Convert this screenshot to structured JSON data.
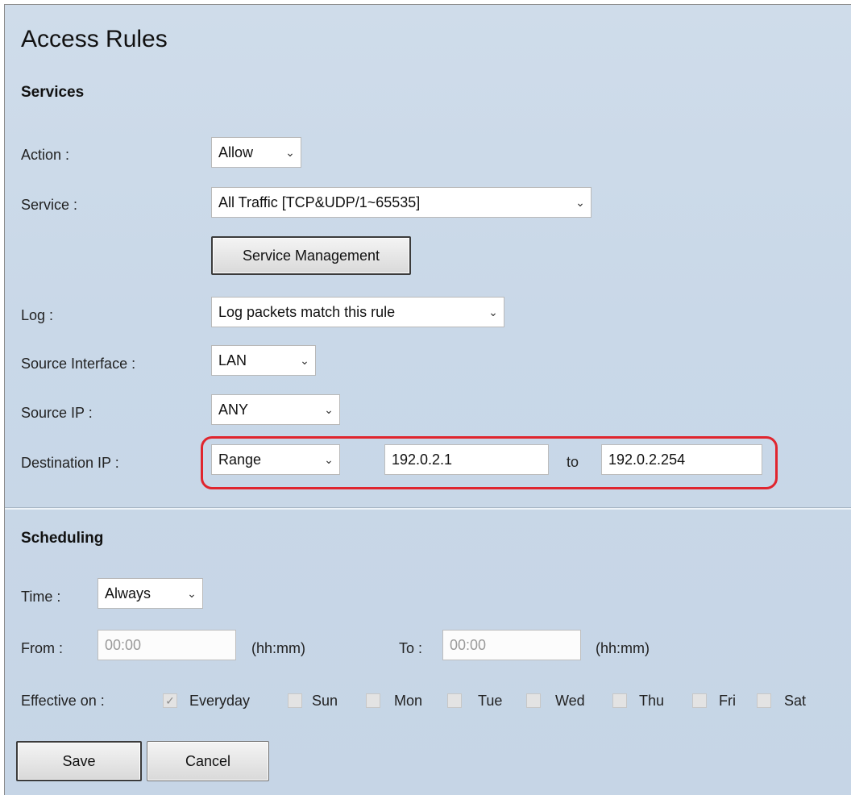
{
  "page": {
    "title": "Access Rules"
  },
  "services": {
    "heading": "Services",
    "action_label": "Action :",
    "action_value": "Allow",
    "service_label": "Service :",
    "service_value": "All Traffic [TCP&UDP/1~65535]",
    "service_mgmt_button": "Service Management",
    "log_label": "Log :",
    "log_value": "Log packets match this rule",
    "source_interface_label": "Source Interface :",
    "source_interface_value": "LAN",
    "source_ip_label": "Source IP :",
    "source_ip_value": "ANY",
    "dest_ip_label": "Destination IP :",
    "dest_ip_mode": "Range",
    "dest_ip_from": "192.0.2.1",
    "dest_ip_to_label": "to",
    "dest_ip_to": "192.0.2.254"
  },
  "scheduling": {
    "heading": "Scheduling",
    "time_label": "Time :",
    "time_value": "Always",
    "from_label": "From :",
    "from_value": "00:00",
    "from_unit": "(hh:mm)",
    "to_label": "To :",
    "to_value": "00:00",
    "to_unit": "(hh:mm)",
    "effective_label": "Effective on :",
    "days": {
      "everyday": "Everyday",
      "sun": "Sun",
      "mon": "Mon",
      "tue": "Tue",
      "wed": "Wed",
      "thu": "Thu",
      "fri": "Fri",
      "sat": "Sat"
    },
    "everyday_checked": true
  },
  "footer": {
    "save_label": "Save",
    "cancel_label": "Cancel"
  },
  "colors": {
    "highlight": "#e0252e",
    "panel_background": "#c9d8e8"
  }
}
